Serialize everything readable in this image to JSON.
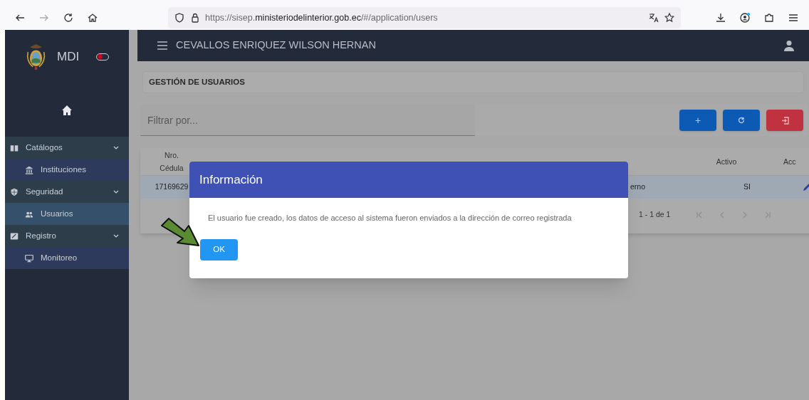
{
  "browser": {
    "url": "https://sisep.**ministeriodelinterior.gob.ec**/#/application/users"
  },
  "sidebar": {
    "brand": "MDI",
    "toggle": {
      "on": false
    },
    "groups": [
      {
        "label": "Catálogos",
        "expanded": true,
        "children": [
          {
            "label": "Instituciones",
            "selected": false
          }
        ]
      },
      {
        "label": "Seguridad",
        "expanded": true,
        "children": [
          {
            "label": "Usuarios",
            "selected": true
          }
        ]
      },
      {
        "label": "Registro",
        "expanded": true,
        "children": [
          {
            "label": "Monitoreo",
            "selected": false
          }
        ]
      }
    ]
  },
  "header": {
    "user": "CEVALLOS ENRIQUEZ WILSON HERNAN"
  },
  "page": {
    "title": "GESTIÓN DE USUARIOS",
    "filter": {
      "placeholder": "Filtrar por..."
    },
    "add_button": "+"
  },
  "table": {
    "columns": [
      {
        "kind": "cedula",
        "label": "Nro. Cédula"
      },
      {
        "kind": "activo",
        "label": "Activo"
      },
      {
        "kind": "acciones",
        "label": "Acc"
      }
    ],
    "rows": [
      {
        "selected": true,
        "cells": [
          {
            "kind": "cedula",
            "text": "17169629"
          },
          {
            "kind": "rol",
            "text": "erno"
          },
          {
            "kind": "activo",
            "text": "SI"
          }
        ]
      }
    ],
    "paginator": "1 - 1 de 1"
  },
  "dialog": {
    "title": "Información",
    "message": "El usuario fue creado, los datos de acceso al sistema fueron enviados a la dirección de correo registrada",
    "button": "OK"
  }
}
